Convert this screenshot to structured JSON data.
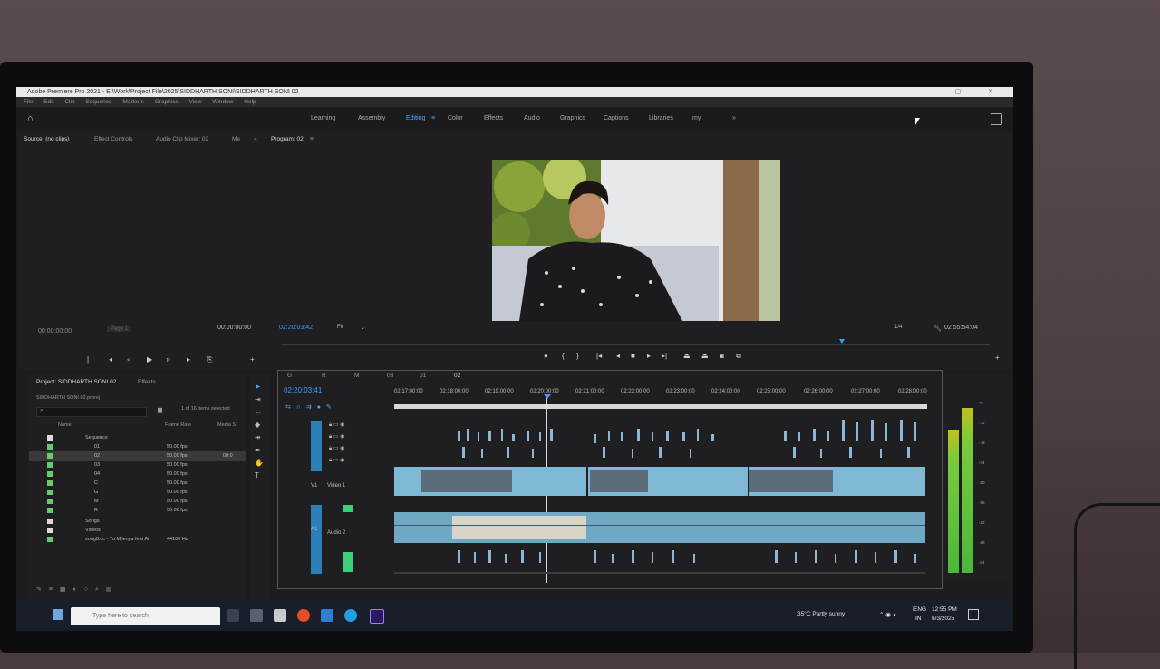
{
  "window": {
    "title": "Adobe Premiere Pro 2021 - E:\\Work\\Project File\\2025\\SIDDHARTH SONI\\SIDDHARTH SONI 02",
    "controls": "– ▢ ✕"
  },
  "menu": [
    "File",
    "Edit",
    "Clip",
    "Sequence",
    "Markers",
    "Graphics",
    "View",
    "Window",
    "Help"
  ],
  "workspaces": {
    "tabs": [
      "Learning",
      "Assembly",
      "Editing",
      "Color",
      "Effects",
      "Audio",
      "Graphics",
      "Captions",
      "Libraries",
      "my"
    ],
    "active": "Editing",
    "more": "»"
  },
  "source_panel": {
    "tabs": [
      "Source: (no clips)",
      "Effect Controls",
      "Audio Clip Mixer: 02",
      "Me"
    ],
    "more": "»",
    "timecode_left": "00:00:00:00",
    "page": "Page 1",
    "timecode_right": "00:00:00:00"
  },
  "program_panel": {
    "title": "Program: 02",
    "timecode": "02:20:03:42",
    "fit": "Fit",
    "quality": "1/4",
    "duration": "02:55:54:04"
  },
  "project_panel": {
    "title": "Project: SIDDHARTH SONI 02",
    "tab2": "Effects",
    "file": "SIDDHARTH SONI 02.prproj",
    "selected": "1 of 16 items selected",
    "columns": {
      "name": "Name",
      "frame_rate": "Frame Rate",
      "media": "Media S"
    },
    "items": [
      {
        "name": "Sequence",
        "fps": ""
      },
      {
        "name": "01",
        "fps": "50.00 fps"
      },
      {
        "name": "02",
        "fps": "50.00 fps"
      },
      {
        "name": "03",
        "fps": "50.00 fps"
      },
      {
        "name": "04",
        "fps": "50.00 fps"
      },
      {
        "name": "C",
        "fps": "50.00 fps"
      },
      {
        "name": "G",
        "fps": "50.00 fps"
      },
      {
        "name": "M",
        "fps": "50.00 fps"
      },
      {
        "name": "R",
        "fps": "50.00 fps"
      },
      {
        "name": "Songs",
        "fps": ""
      },
      {
        "name": "Videos",
        "fps": ""
      },
      {
        "name": "song8.cc - Tu Milenya feat Ai",
        "fps": "44100 Hz"
      }
    ],
    "media_val": "00;0"
  },
  "timeline": {
    "tabs": [
      "G",
      "R",
      "M",
      "03",
      "01",
      "02"
    ],
    "timecode": "02:20:03:41",
    "ruler": [
      "02:17:00:00",
      "02:18:00:00",
      "02:19:00:00",
      "02:20:00:00",
      "02:21:00:00",
      "02:22:00:00",
      "02:23:00:00",
      "02:24:00:00",
      "02:25:00:00",
      "02:26:00:00",
      "02:27:00:00",
      "02:28:00:00"
    ],
    "video_track_label": "Video 1",
    "v1": "V1",
    "audio_track_label": "Audio 2",
    "a1": "A1"
  },
  "meter_scale": [
    "-6",
    "-12",
    "-18",
    "-24",
    "-30",
    "-36",
    "-42",
    "-48",
    "-54"
  ],
  "taskbar": {
    "search_placeholder": "Type here to search",
    "weather": "35°C Partly sunny",
    "lang": "ENG",
    "region": "IN",
    "time": "12:55 PM",
    "date": "6/3/2025"
  },
  "colors": {
    "accent": "#3f9cff",
    "clip_video": "#7fb8d4",
    "label_green": "#66cc66",
    "meter": "#4ab83a"
  }
}
